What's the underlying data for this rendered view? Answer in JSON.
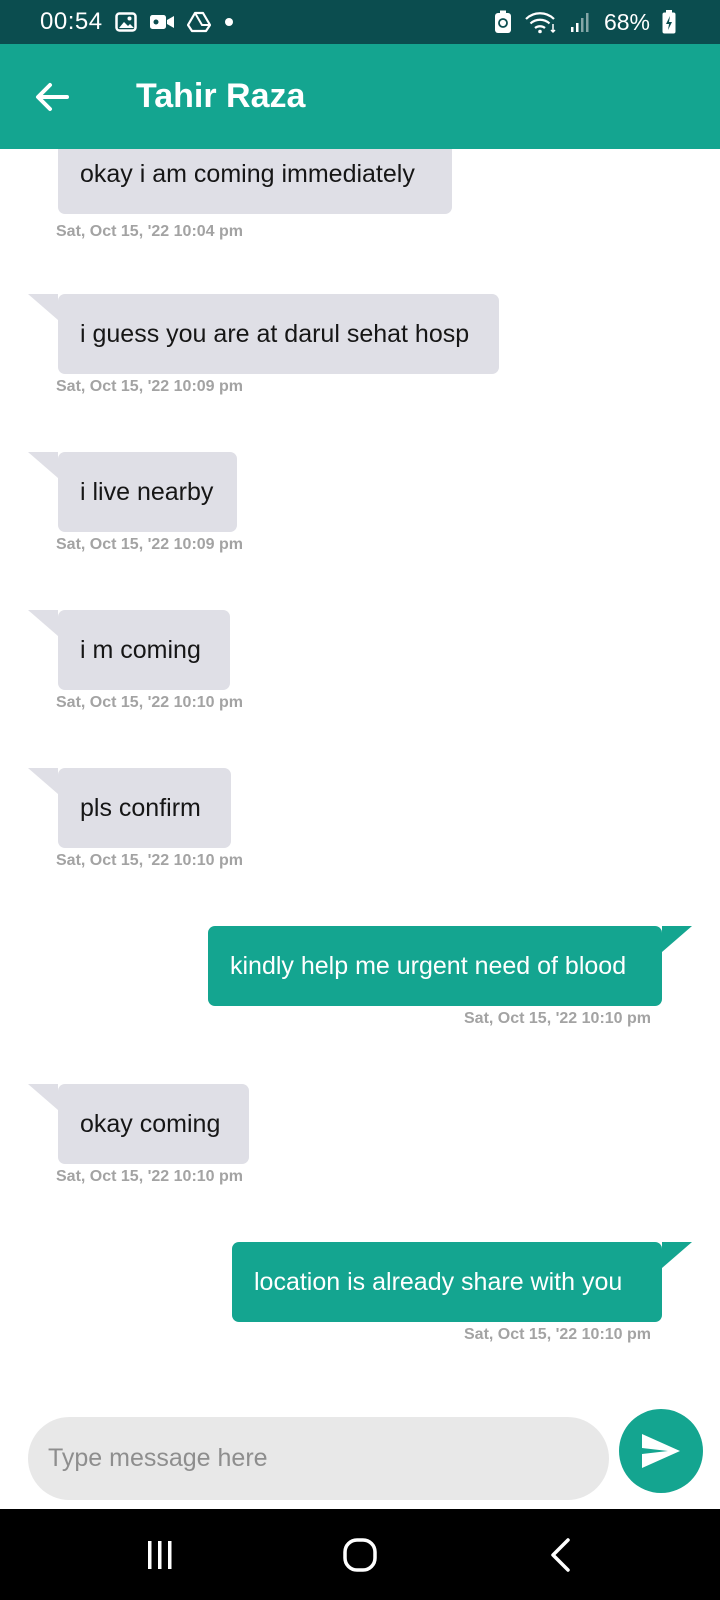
{
  "status_bar": {
    "time": "00:54",
    "battery_percent": "68%",
    "icons_left": [
      "gallery-icon",
      "video-icon",
      "drive-icon",
      "dot-icon"
    ],
    "icons_right": [
      "recycle-icon",
      "wifi-icon",
      "signal-icon",
      "battery-icon"
    ]
  },
  "header": {
    "back_icon": "arrow-left-icon",
    "contact_name": "Tahir Raza"
  },
  "messages": [
    {
      "direction": "in",
      "text": "okay i am coming immediately",
      "timestamp": "Sat, Oct 15, '22  10:04 pm"
    },
    {
      "direction": "in",
      "text": "i guess you are at darul sehat hosp",
      "timestamp": "Sat, Oct 15, '22  10:09 pm"
    },
    {
      "direction": "in",
      "text": "i live nearby",
      "timestamp": "Sat, Oct 15, '22  10:09 pm"
    },
    {
      "direction": "in",
      "text": "i m coming",
      "timestamp": "Sat, Oct 15, '22  10:10 pm"
    },
    {
      "direction": "in",
      "text": "pls confirm",
      "timestamp": "Sat, Oct 15, '22  10:10 pm"
    },
    {
      "direction": "out",
      "text": "kindly help me urgent need of blood",
      "timestamp": "Sat, Oct 15, '22  10:10 pm"
    },
    {
      "direction": "in",
      "text": "okay coming",
      "timestamp": "Sat, Oct 15, '22  10:10 pm"
    },
    {
      "direction": "out",
      "text": "location is already share with you",
      "timestamp": "Sat, Oct 15, '22  10:10 pm"
    }
  ],
  "composer": {
    "placeholder": "Type message here",
    "value": "",
    "send_icon": "send-icon"
  },
  "nav_bar": {
    "icons": [
      "recents-icon",
      "home-icon",
      "back-nav-icon"
    ]
  },
  "colors": {
    "status_bar": "#0b4d4f",
    "accent": "#14a590",
    "incoming_bubble": "#dfdfe6",
    "timestamp": "#a3a3a3"
  }
}
